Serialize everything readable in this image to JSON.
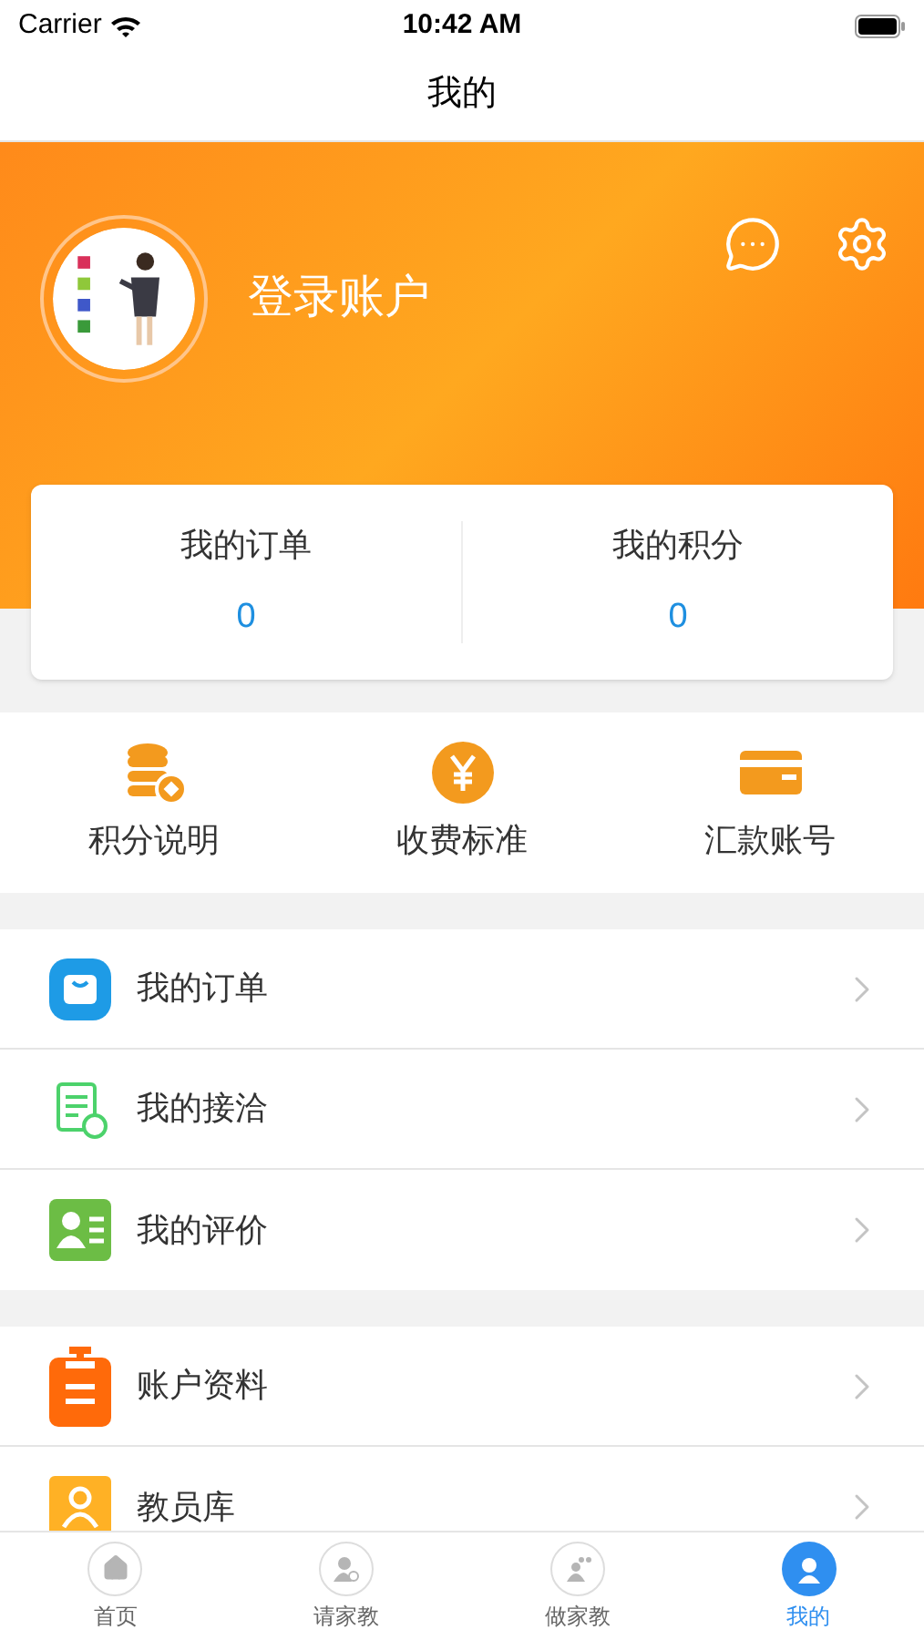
{
  "status_bar": {
    "carrier": "Carrier",
    "time": "10:42 AM"
  },
  "nav_bar": {
    "title": "我的"
  },
  "profile": {
    "login_text": "登录账户"
  },
  "summary": [
    {
      "label": "我的订单",
      "value": "0"
    },
    {
      "label": "我的积分",
      "value": "0"
    }
  ],
  "shortcuts": [
    {
      "kind": "coins",
      "label": "积分说明"
    },
    {
      "kind": "yen",
      "label": "收费标准"
    },
    {
      "kind": "card",
      "label": "汇款账号"
    }
  ],
  "menu_groups": [
    [
      {
        "kind": "bag",
        "label": "我的订单"
      },
      {
        "kind": "doc",
        "label": "我的接洽"
      },
      {
        "kind": "contact",
        "label": "我的评价"
      }
    ],
    [
      {
        "kind": "clipboard",
        "label": "账户资料"
      },
      {
        "kind": "person",
        "label": "教员库"
      }
    ]
  ],
  "tab_bar": [
    {
      "kind": "home",
      "label": "首页",
      "selected": false
    },
    {
      "kind": "search-person",
      "label": "请家教",
      "selected": false
    },
    {
      "kind": "teach",
      "label": "做家教",
      "selected": false
    },
    {
      "kind": "me",
      "label": "我的",
      "selected": true
    }
  ]
}
